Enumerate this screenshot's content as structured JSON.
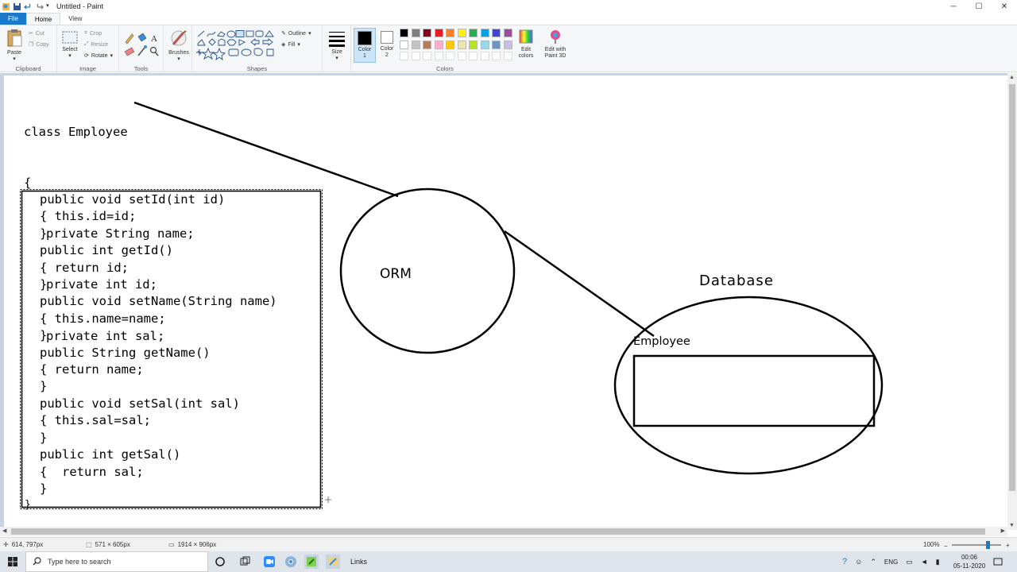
{
  "window": {
    "title": "Untitled - Paint",
    "controls": [
      "minimize",
      "maximize",
      "close"
    ]
  },
  "tabs": [
    "File",
    "Home",
    "View"
  ],
  "ribbon": {
    "clipboard": {
      "label": "Clipboard",
      "paste": "Paste",
      "cut": "Cut",
      "copy": "Copy"
    },
    "image": {
      "label": "Image",
      "select": "Select",
      "crop": "Crop",
      "resize": "Resize",
      "rotate": "Rotate"
    },
    "tools": {
      "label": "Tools"
    },
    "brushes": {
      "label": "Brushes"
    },
    "shapes": {
      "label": "Shapes",
      "outline": "Outline",
      "fill": "Fill"
    },
    "size": {
      "label": "Size"
    },
    "color1": {
      "label": "Color 1"
    },
    "color2": {
      "label": "Color 2"
    },
    "colors": {
      "label": "Colors",
      "edit": "Edit colors",
      "row1": [
        "#000000",
        "#7f7f7f",
        "#880015",
        "#ed1c24",
        "#ff7f27",
        "#fff200",
        "#22b14c",
        "#00a2e8",
        "#3f48cc",
        "#a349a4"
      ],
      "row2": [
        "#ffffff",
        "#c3c3c3",
        "#b97a57",
        "#ffaec9",
        "#ffc90e",
        "#efe4b0",
        "#b5e61d",
        "#99d9ea",
        "#7092be",
        "#c8bfe7"
      ]
    },
    "paint3d": {
      "label": "Edit with Paint 3D"
    }
  },
  "drawing": {
    "class_header": [
      "class Employee",
      "{",
      "   private String name;",
      "   private int id;",
      "   private int sal;"
    ],
    "methods": [
      "public void setId(int id)",
      "{ this.id=id;",
      "}",
      "public int getId()",
      "{ return id;",
      "}",
      "public void setName(String name)",
      "{ this.name=name;",
      "}",
      "public String getName()",
      "{ return name;",
      "}",
      "public void setSal(int sal)",
      "{ this.sal=sal;",
      "}",
      "public int getSal()",
      "{  return sal;",
      "}"
    ],
    "closing_brace": "}",
    "orm_label": "ORM",
    "database_label": "Database",
    "table_label": "Employee"
  },
  "status": {
    "cursor": "614, 797px",
    "selection": "571 × 605px",
    "canvas_size": "1914 × 906px",
    "zoom": "100%",
    "zoom_level": 0.73
  },
  "taskbar": {
    "search_placeholder": "Type here to search",
    "links": "Links",
    "lang": "ENG",
    "time": "00:06",
    "date": "05-11-2020"
  }
}
